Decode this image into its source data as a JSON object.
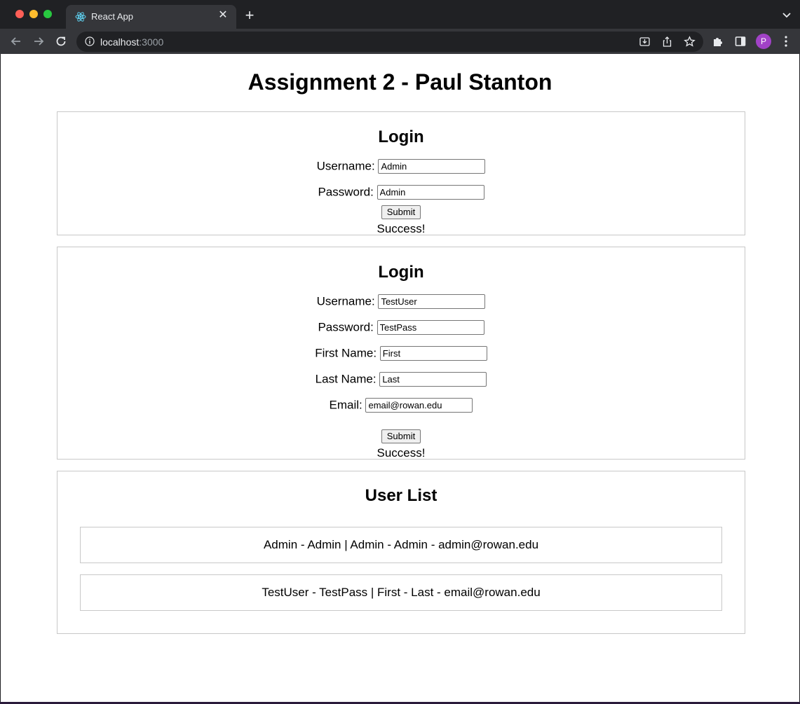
{
  "browser": {
    "tab_title": "React App",
    "url_host": "localhost",
    "url_port": ":3000",
    "profile_initial": "P"
  },
  "page": {
    "title": "Assignment 2 - Paul Stanton"
  },
  "login_form": {
    "heading": "Login",
    "username_label": "Username:",
    "username_value": "Admin",
    "password_label": "Password:",
    "password_value": "Admin",
    "submit_label": "Submit",
    "status": "Success!"
  },
  "register_form": {
    "heading": "Login",
    "username_label": "Username:",
    "username_value": "TestUser",
    "password_label": "Password:",
    "password_value": "TestPass",
    "first_name_label": "First Name:",
    "first_name_value": "First",
    "last_name_label": "Last Name:",
    "last_name_value": "Last",
    "email_label": "Email:",
    "email_value": "email@rowan.edu",
    "submit_label": "Submit",
    "status": "Success!"
  },
  "user_list": {
    "heading": "User List",
    "items": [
      "Admin - Admin | Admin - Admin - admin@rowan.edu",
      "TestUser - TestPass | First - Last - email@rowan.edu"
    ]
  }
}
